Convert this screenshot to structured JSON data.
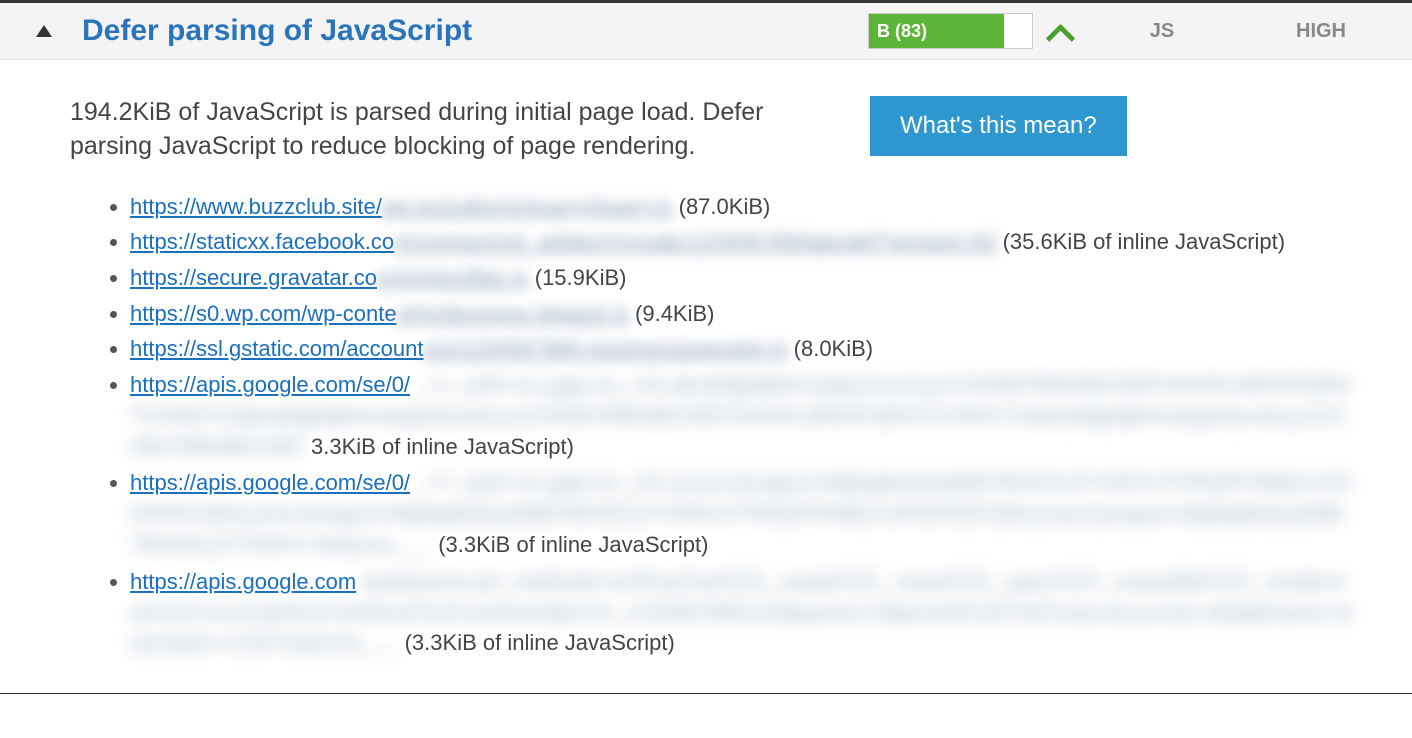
{
  "header": {
    "title": "Defer parsing of JavaScript",
    "score_label": "B (83)",
    "score_percent": 83,
    "type": "JS",
    "priority": "HIGH"
  },
  "description": "194.2KiB of JavaScript is parsed during initial page load. Defer parsing JavaScript to reduce blocking of page rendering.",
  "help_button": "What's this mean?",
  "items": [
    {
      "url": "https://www.buzzclub.site/",
      "blurred_tail": "wp-includes/js/jquery/jquery.js",
      "size": "(87.0KiB)"
    },
    {
      "url": "https://staticxx.facebook.co",
      "blurred_tail": "m/connect/xd_arbiter/r/xyzabc1234567890abcdef?version=42",
      "size": "(35.6KiB of inline JavaScript)"
    },
    {
      "url": "https://secure.gravatar.co",
      "blurred_tail": "m/js/gprofiles.js",
      "size": "(15.9KiB)"
    },
    {
      "url": "https://s0.wp.com/wp-conte",
      "blurred_tail": "nt/js/devicepx-jetpack.js",
      "size": "(9.4KiB)"
    },
    {
      "url": "https://ssl.gstatic.com/account",
      "blurred_tail": "s/o/1234567890-postmessagerelay.js",
      "size": "(8.0KiB)"
    },
    {
      "url": "https://apis.google.com/se/0/",
      "blurred_block": "_/+/_/js/k=oz.gapi.en_US.abcdefghijklmnopqrstuvwxyz1234567890ABCDEFGHIJKLMNOPQRSTUVWXYZabcdefghijklmnopqrstuvwxyz1234567890ABCDEFGHIJKLMNOPQRSTUVWXYZabcdefghijklmnopqrstuvwxyz1234567890ABCDEF",
      "mid_size": "3.3KiB of inline JavaScript)",
      "tail": ""
    },
    {
      "url": "https://apis.google.com/se/0/",
      "blurred_block": "_/+/_/js/k=oz.gapi.en_US.zyxwvutsrqponmlkjihgfedcba0987654321ZYXWVUTSRQPONMLKJIHGFEDCBAzyxwvutsrqponmlkjihgfedcba0987654321ZYXWVUTSRQPONMLKJIHGFEDCBAzyxwvutsrqponmlkjihgfedcba0987654321ZYXWVU features___",
      "tail": "(3.3KiB of inline JavaScript)"
    },
    {
      "url": "https://apis.google.com",
      "blurred_block": "/js/plusone.js#_methods=onPlusOne%2C_ready%2C_close%2C_open%2C_resizeMe%2C_renderstart%2Concircled%2Cdrefresh%2Cerefresh&id=I0_1234567890123&parent=https%3A%2F%2Fwww.buzzclub.site&pfname=&rpctoken=1234 features___",
      "tail": "(3.3KiB of inline JavaScript)"
    }
  ]
}
